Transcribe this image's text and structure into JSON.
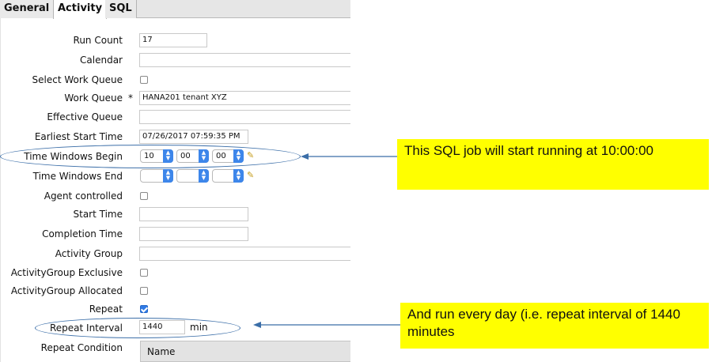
{
  "tabs": [
    {
      "label": "General",
      "active": false
    },
    {
      "label": "Activity",
      "active": true
    },
    {
      "label": "SQL",
      "active": false
    }
  ],
  "form": {
    "run_count_label": "Run Count",
    "run_count_value": "17",
    "calendar_label": "Calendar",
    "select_work_queue_label": "Select Work Queue",
    "select_work_queue_checked": false,
    "work_queue_label": "Work Queue",
    "required_marker": "*",
    "work_queue_value": "HANA201 tenant XYZ",
    "effective_queue_label": "Effective Queue",
    "earliest_start_label": "Earliest Start Time",
    "earliest_start_value": "07/26/2017 07:59:35 PM",
    "tw_begin_label": "Time Windows Begin",
    "tw_begin_hour": "10",
    "tw_begin_min": "00",
    "tw_begin_sec": "00",
    "tw_end_label": "Time Windows End",
    "agent_controlled_label": "Agent controlled",
    "agent_controlled_checked": false,
    "start_time_label": "Start Time",
    "completion_time_label": "Completion Time",
    "activity_group_label": "Activity Group",
    "ag_exclusive_label": "ActivityGroup Exclusive",
    "ag_exclusive_checked": false,
    "ag_allocated_label": "ActivityGroup Allocated",
    "ag_allocated_checked": false,
    "repeat_label": "Repeat",
    "repeat_checked": true,
    "repeat_interval_label": "Repeat Interval",
    "repeat_interval_value": "1440",
    "repeat_interval_unit": "min",
    "repeat_condition_label": "Repeat Condition",
    "repeat_condition_column": "Name"
  },
  "annotations": {
    "note1": "This SQL job will start running at 10:00:00",
    "note2": "And run every day (i.e. repeat interval of 1440 minutes"
  },
  "colors": {
    "highlight": "#ffff00",
    "annotation_line": "#3b6ea8",
    "select_arrow": "#3d86ea"
  },
  "icons": {
    "clear": "eraser-icon",
    "dropdown": "chevron-updown-icon"
  }
}
